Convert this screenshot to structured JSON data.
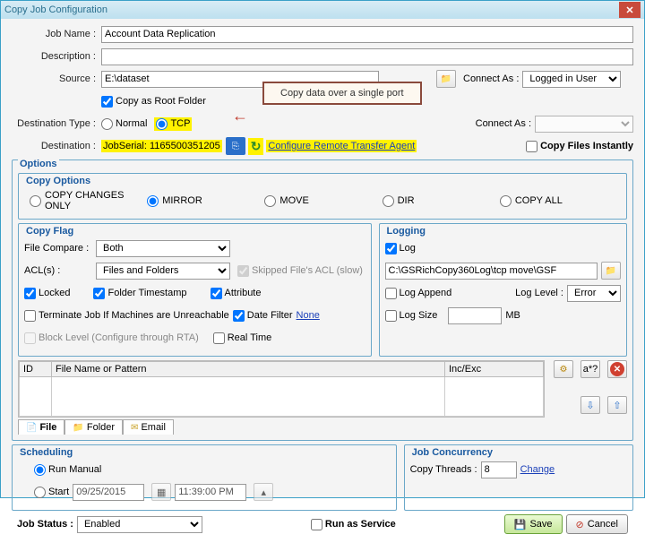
{
  "window": {
    "title": "Copy Job Configuration"
  },
  "form": {
    "jobname_label": "Job Name :",
    "jobname_value": "Account Data Replication",
    "description_label": "Description :",
    "description_value": "",
    "source_label": "Source :",
    "source_value": "E:\\dataset",
    "connectas_label": "Connect As :",
    "connectas_value": "Logged in User",
    "copy_as_root": "Copy as Root Folder",
    "callout_text": "Copy data over a single port",
    "desttype_label": "Destination Type :",
    "desttype_normal": "Normal",
    "desttype_tcp": "TCP",
    "connectas2_label": "Connect As :",
    "connectas2_value": "",
    "destination_label": "Destination :",
    "jobserial_text": "JobSerial: 1165500351205",
    "configure_link": "Configure Remote Transfer Agent",
    "copy_instantly": "Copy Files Instantly"
  },
  "options": {
    "legend": "Options",
    "copyoptions_legend": "Copy Options",
    "opt_changes": "COPY CHANGES ONLY",
    "opt_mirror": "MIRROR",
    "opt_move": "MOVE",
    "opt_dir": "DIR",
    "opt_all": "COPY ALL"
  },
  "copyflag": {
    "legend": "Copy Flag",
    "filecompare_label": "File Compare :",
    "filecompare_value": "Both",
    "acl_label": "ACL(s) :",
    "acl_value": "Files and Folders",
    "skipped_acl": "Skipped File's ACL (slow)",
    "locked": "Locked",
    "folder_ts": "Folder Timestamp",
    "attribute": "Attribute",
    "terminate": "Terminate Job If Machines are Unreachable",
    "datefilter": "Date Filter",
    "datefilter_link": "None",
    "block_level": "Block Level (Configure through RTA)",
    "realtime": "Real Time"
  },
  "logging": {
    "legend": "Logging",
    "log_cb": "Log",
    "log_path": "C:\\GSRichCopy360Log\\tcp move\\GSF",
    "log_append": "Log Append",
    "loglevel_label": "Log Level :",
    "loglevel_value": "Error",
    "log_size": "Log Size",
    "mb": "MB"
  },
  "grid": {
    "col_id": "ID",
    "col_name": "File Name or Pattern",
    "col_incexc": "Inc/Exc",
    "wildcard": "a*?"
  },
  "tabs": {
    "file": "File",
    "folder": "Folder",
    "email": "Email"
  },
  "scheduling": {
    "legend": "Scheduling",
    "run_manual": "Run Manual",
    "start": "Start",
    "date": "09/25/2015",
    "time": "11:39:00 PM"
  },
  "concurrency": {
    "legend": "Job Concurrency",
    "threads_label": "Copy Threads :",
    "threads_value": "8",
    "change": "Change"
  },
  "footer": {
    "jobstatus_label": "Job Status :",
    "jobstatus_value": "Enabled",
    "run_service": "Run as Service",
    "save": "Save",
    "cancel": "Cancel"
  }
}
